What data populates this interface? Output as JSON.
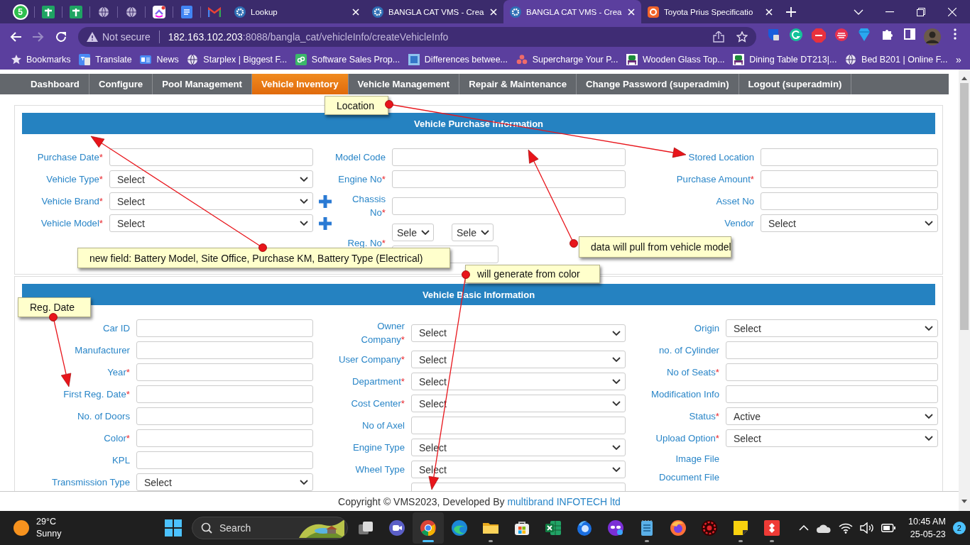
{
  "browser": {
    "pinned_badge": "5",
    "tabs": [
      {
        "title": "Lookup",
        "kind": "app",
        "selected": false
      },
      {
        "title": "BANGLA CAT VMS - Crea",
        "kind": "app",
        "selected": false
      },
      {
        "title": "BANGLA CAT VMS - Crea",
        "kind": "app",
        "selected": true
      },
      {
        "title": "Toyota Prius Specificatio",
        "kind": "site",
        "selected": false
      }
    ],
    "security": "Not secure",
    "url_host": "182.163.102.203",
    "url_path": ":8088/bangla_cat/vehicleInfo/createVehicleInfo",
    "bookmarks": [
      {
        "title": "Bookmarks",
        "kind": "star"
      },
      {
        "title": "Translate",
        "kind": "translate"
      },
      {
        "title": "News",
        "kind": "news"
      },
      {
        "title": "Starplex | Biggest F...",
        "kind": "globe"
      },
      {
        "title": "Software Sales Prop...",
        "kind": "pd"
      },
      {
        "title": "Differences betwee...",
        "kind": "square"
      },
      {
        "title": "Supercharge Your P...",
        "kind": "dots"
      },
      {
        "title": "Wooden Glass Top...",
        "kind": "chair"
      },
      {
        "title": "Dining Table DT213|...",
        "kind": "chair"
      },
      {
        "title": "Bed B201 | Online F...",
        "kind": "globe"
      }
    ],
    "more": "»"
  },
  "nav": [
    {
      "label": "Dashboard",
      "selected": false
    },
    {
      "label": "Configure",
      "selected": false
    },
    {
      "label": "Pool Management",
      "selected": false
    },
    {
      "label": "Vehicle Inventory",
      "selected": true
    },
    {
      "label": "Vehicle Management",
      "selected": false
    },
    {
      "label": "Repair & Maintenance",
      "selected": false
    },
    {
      "label": "Change Password (superadmin)",
      "selected": false
    },
    {
      "label": "Logout (superadmin)",
      "selected": false
    }
  ],
  "sections": [
    {
      "title": "Vehicle Purchase Information",
      "columns": [
        [
          {
            "label": "Purchase Date",
            "mark": "*",
            "kind": "text"
          },
          {
            "label": "Vehicle Type",
            "mark": "*",
            "kind": "select",
            "value": "Select"
          },
          {
            "label": "Vehicle Brand",
            "mark": "*",
            "kind": "select",
            "value": "Select",
            "addable": true
          },
          {
            "label": "Vehicle Model",
            "mark": "*",
            "kind": "select",
            "value": "Select",
            "addable": true
          }
        ],
        [
          {
            "label": "Model Code",
            "kind": "text"
          },
          {
            "label": "Engine No",
            "mark": "*",
            "kind": "text"
          },
          {
            "label": "Chassis No",
            "mark": "*",
            "kind": "text"
          },
          {
            "label": "Reg. No",
            "mark": "*",
            "kind": "regno",
            "selects": [
              "Sele",
              "Sele"
            ]
          }
        ],
        [
          {
            "label": "Stored Location",
            "kind": "text"
          },
          {
            "label": "Purchase Amount",
            "mark": "*",
            "kind": "text"
          },
          {
            "label": "Asset No",
            "kind": "text"
          },
          {
            "label": "Vendor",
            "kind": "select",
            "value": "Select"
          }
        ]
      ]
    },
    {
      "title": "Vehicle Basic Information",
      "columns": [
        [
          {
            "label": "Car ID",
            "kind": "text"
          },
          {
            "label": "Manufacturer",
            "kind": "text"
          },
          {
            "label": "Year",
            "mark": "*",
            "kind": "text"
          },
          {
            "label": "First Reg. Date",
            "mark": "*",
            "kind": "text"
          },
          {
            "label": "No. of Doors",
            "kind": "text"
          },
          {
            "label": "Color",
            "mark": "*",
            "kind": "text"
          },
          {
            "label": "KPL",
            "kind": "text"
          },
          {
            "label": "Transmission Type",
            "kind": "select",
            "value": "Select"
          }
        ],
        [
          {
            "label": "Owner Company",
            "mark": "*",
            "kind": "select",
            "value": "Select"
          },
          {
            "label": "User Company",
            "mark": "*",
            "kind": "select",
            "value": "Select"
          },
          {
            "label": "Department",
            "mark": "*",
            "kind": "select",
            "value": "Select"
          },
          {
            "label": "Cost Center",
            "mark": "*",
            "kind": "select",
            "value": "Select"
          },
          {
            "label": "No of Axel",
            "kind": "text"
          },
          {
            "label": "Engine Type",
            "kind": "select",
            "value": "Select"
          },
          {
            "label": "Wheel Type",
            "kind": "select",
            "value": "Select"
          },
          {
            "kind": "blank"
          }
        ],
        [
          {
            "label": "Origin",
            "kind": "select",
            "value": "Select"
          },
          {
            "label": "no. of Cylinder",
            "kind": "text"
          },
          {
            "label": "No of Seats",
            "mark": "*",
            "kind": "text"
          },
          {
            "label": "Modification Info",
            "kind": "text"
          },
          {
            "label": "Status",
            "mark": "*",
            "kind": "select",
            "value": "Active"
          },
          {
            "label": "Upload Option",
            "mark": "*",
            "kind": "select",
            "value": "Select"
          },
          {
            "label": "Image File",
            "kind": "label"
          },
          {
            "label": "Document File",
            "kind": "label"
          }
        ]
      ]
    }
  ],
  "annotations": [
    {
      "text": "Location"
    },
    {
      "text": "new field: Battery Model, Site Office, Purchase KM, Battery Type (Electrical)"
    },
    {
      "text": "data will pull from vehicle model"
    },
    {
      "text": "will generate from color"
    },
    {
      "text": "Reg. Date"
    }
  ],
  "footer": {
    "text": "Copyright © VMS2023, Developed By",
    "link": "multibrand INFOTECH ltd"
  },
  "taskbar": {
    "temperature": "29°C",
    "weather": "Sunny",
    "search": "Search",
    "apps": [
      {
        "kind": "taskview",
        "running": false,
        "selected": false
      },
      {
        "kind": "meet",
        "running": false,
        "selected": false
      },
      {
        "kind": "chrome",
        "running": true,
        "selected": true
      },
      {
        "kind": "edge",
        "running": false,
        "selected": false
      },
      {
        "kind": "folder",
        "running": true,
        "selected": false
      },
      {
        "kind": "store",
        "running": false,
        "selected": false
      },
      {
        "kind": "excel",
        "running": false,
        "selected": false
      },
      {
        "kind": "bluefox",
        "running": false,
        "selected": false
      },
      {
        "kind": "mask",
        "running": false,
        "selected": false
      },
      {
        "kind": "notepad",
        "running": true,
        "selected": false
      },
      {
        "kind": "firefox",
        "running": false,
        "selected": false
      },
      {
        "kind": "redgear",
        "running": false,
        "selected": false
      },
      {
        "kind": "sticky",
        "running": true,
        "selected": false
      },
      {
        "kind": "remote",
        "running": true,
        "selected": false
      }
    ],
    "time": "10:45 AM",
    "date": "25-05-23",
    "notifications": "2"
  }
}
